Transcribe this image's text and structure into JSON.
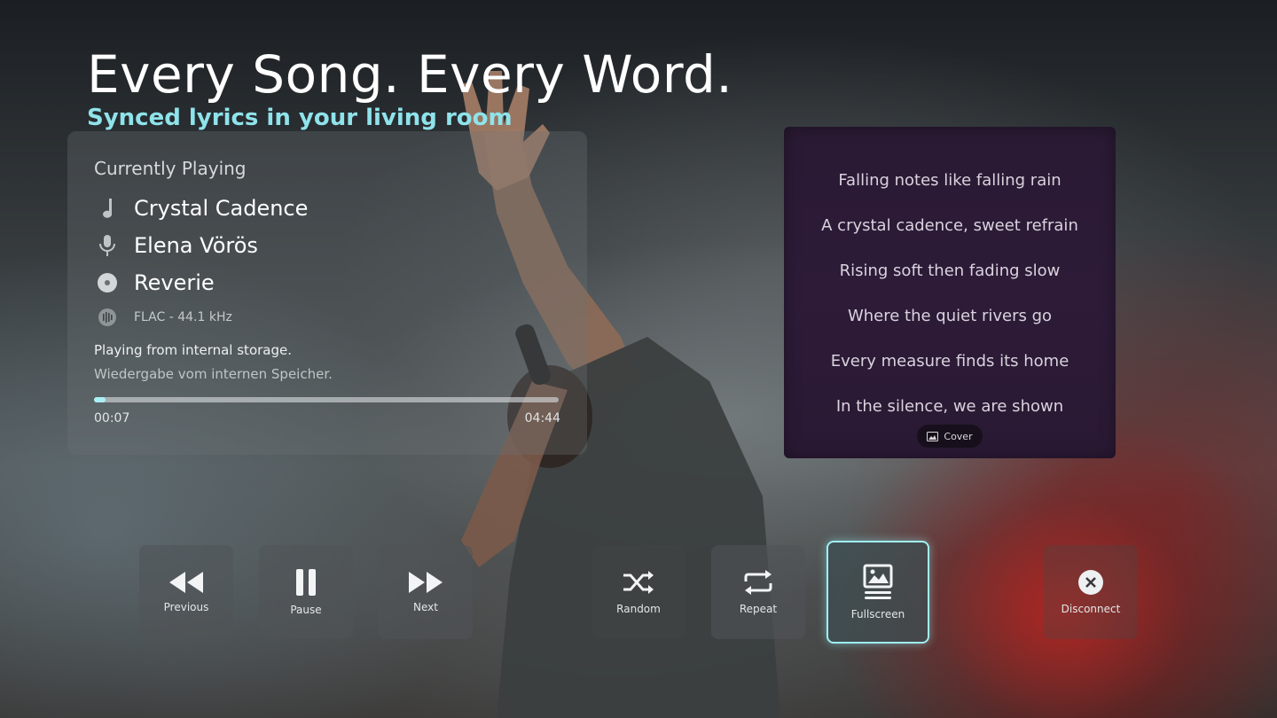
{
  "hero": {
    "headline": "Every Song. Every Word.",
    "tagline": "Synced lyrics in your living room"
  },
  "now_playing": {
    "heading": "Currently Playing",
    "title": "Crystal Cadence",
    "artist": "Elena Vörös",
    "album": "Reverie",
    "format": "FLAC - 44.1 kHz",
    "source_note_en": "Playing from internal storage.",
    "source_note_de": "Wiedergabe vom internen Speicher.",
    "elapsed": "00:07",
    "duration": "04:44",
    "progress_fraction": 0.025,
    "icons": {
      "title": "music-note-icon",
      "artist": "microphone-icon",
      "album": "disc-icon",
      "format": "waveform-icon"
    }
  },
  "lyrics": {
    "lines": [
      "Falling notes like falling rain",
      "A crystal cadence, sweet refrain",
      "Rising soft then fading slow",
      "Where the quiet rivers go",
      "Every measure finds its home",
      "In the silence, we are shown"
    ],
    "cover_label": "Cover"
  },
  "controls": {
    "previous": "Previous",
    "pause": "Pause",
    "next": "Next",
    "random": "Random",
    "repeat": "Repeat",
    "fullscreen": "Fullscreen",
    "disconnect": "Disconnect"
  },
  "colors": {
    "accent": "#8fe3ea",
    "focus_ring": "#9ff0f4",
    "lyrics_panel": "#2b1a35"
  }
}
